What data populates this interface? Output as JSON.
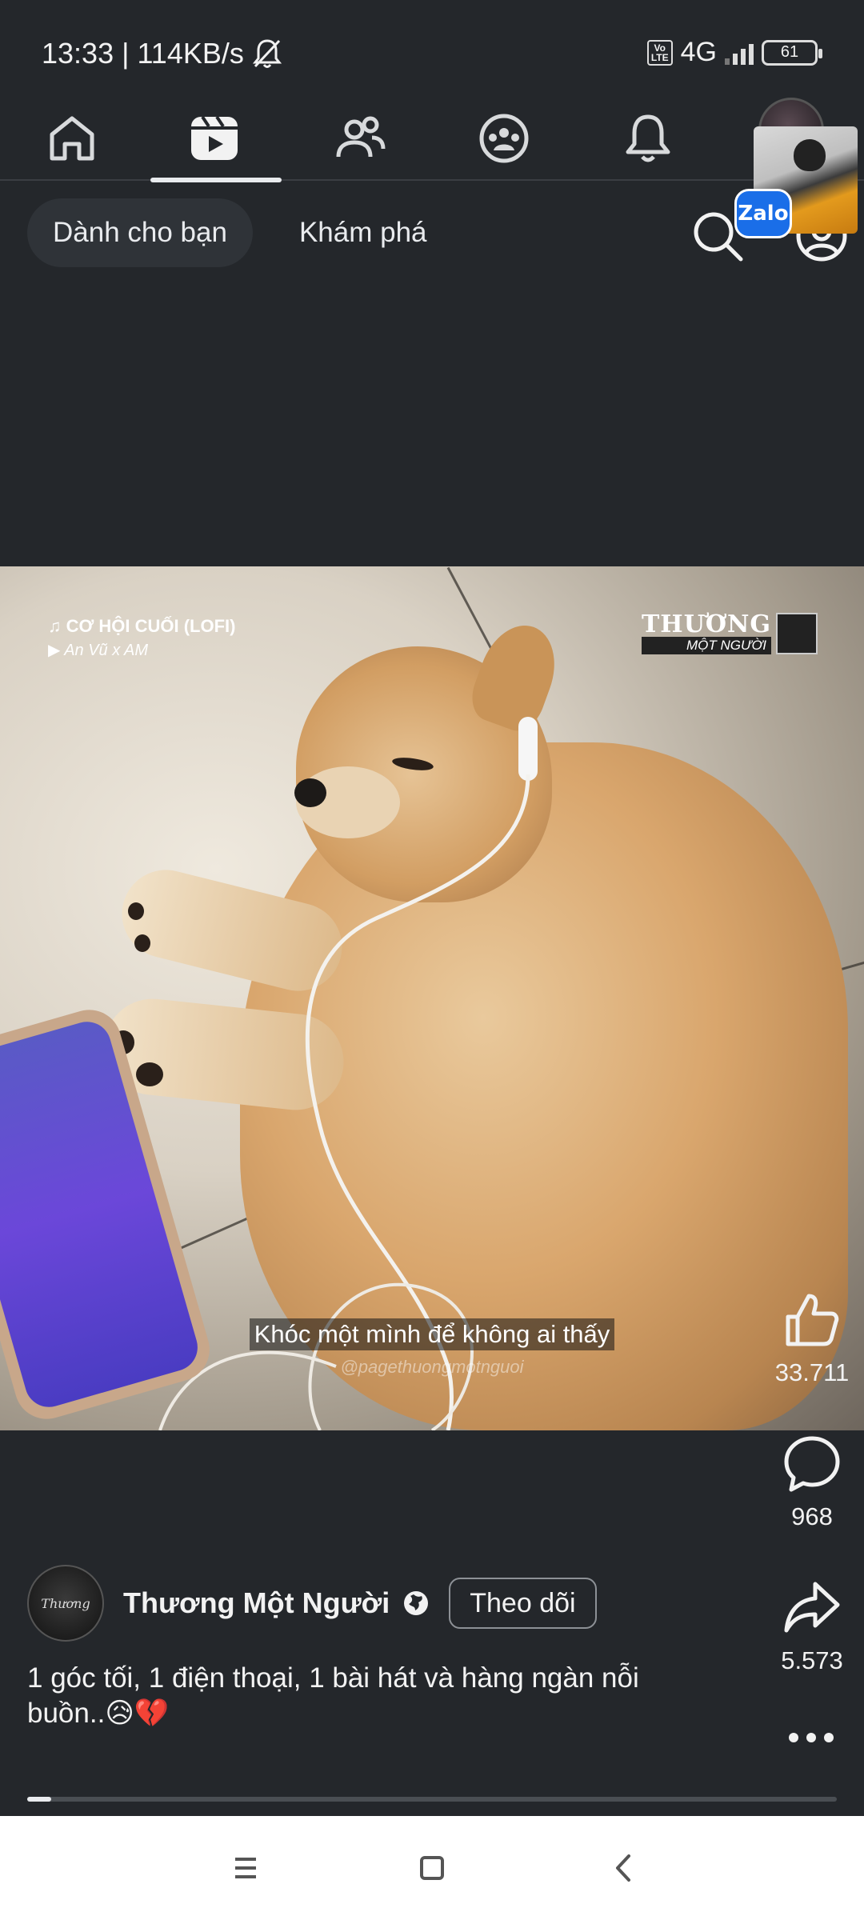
{
  "status_bar": {
    "time": "13:33",
    "separator": "|",
    "speed": "114KB/s",
    "network": "4G",
    "volte": "Vo\nLTE",
    "battery": "61",
    "icons": [
      "mute-bell-icon",
      "signal-icon",
      "battery-icon"
    ]
  },
  "top_nav": {
    "tabs": [
      {
        "name": "home",
        "icon": "home-icon",
        "active": false
      },
      {
        "name": "video",
        "icon": "video-icon",
        "active": true
      },
      {
        "name": "friends",
        "icon": "friends-icon",
        "active": false
      },
      {
        "name": "groups",
        "icon": "groups-icon",
        "active": false
      },
      {
        "name": "notifications",
        "icon": "bell-icon",
        "active": false
      }
    ]
  },
  "chips": {
    "for_you": "Dành cho bạn",
    "explore": "Khám phá"
  },
  "zalo": {
    "label": "Zalo"
  },
  "video": {
    "song_title": "♫ CƠ HỘI CUỐI (LOFI)",
    "song_artist": "▶ An Vũ x AM",
    "brand_title": "THƯƠNG",
    "brand_subtitle": "MỘT NGƯỜI",
    "subtitle": "Khóc một mình để không ai thấy",
    "watermark": "@pagethuongmotnguoi"
  },
  "actions": {
    "likes": "33.711",
    "comments": "968",
    "shares": "5.573"
  },
  "post": {
    "author_name": "Thương Một Người",
    "author_avatar_text": "Thương",
    "follow_label": "Theo dõi",
    "caption_text": "1 góc tối, 1 điện thoại, 1 bài hát và hàng ngàn nỗi buồn..",
    "caption_emoji": "😥💔"
  },
  "progress": {
    "fraction": 0.03
  },
  "colors": {
    "background": "#24272b",
    "text": "#e9ebee",
    "zalo_blue": "#1a6ee8"
  }
}
